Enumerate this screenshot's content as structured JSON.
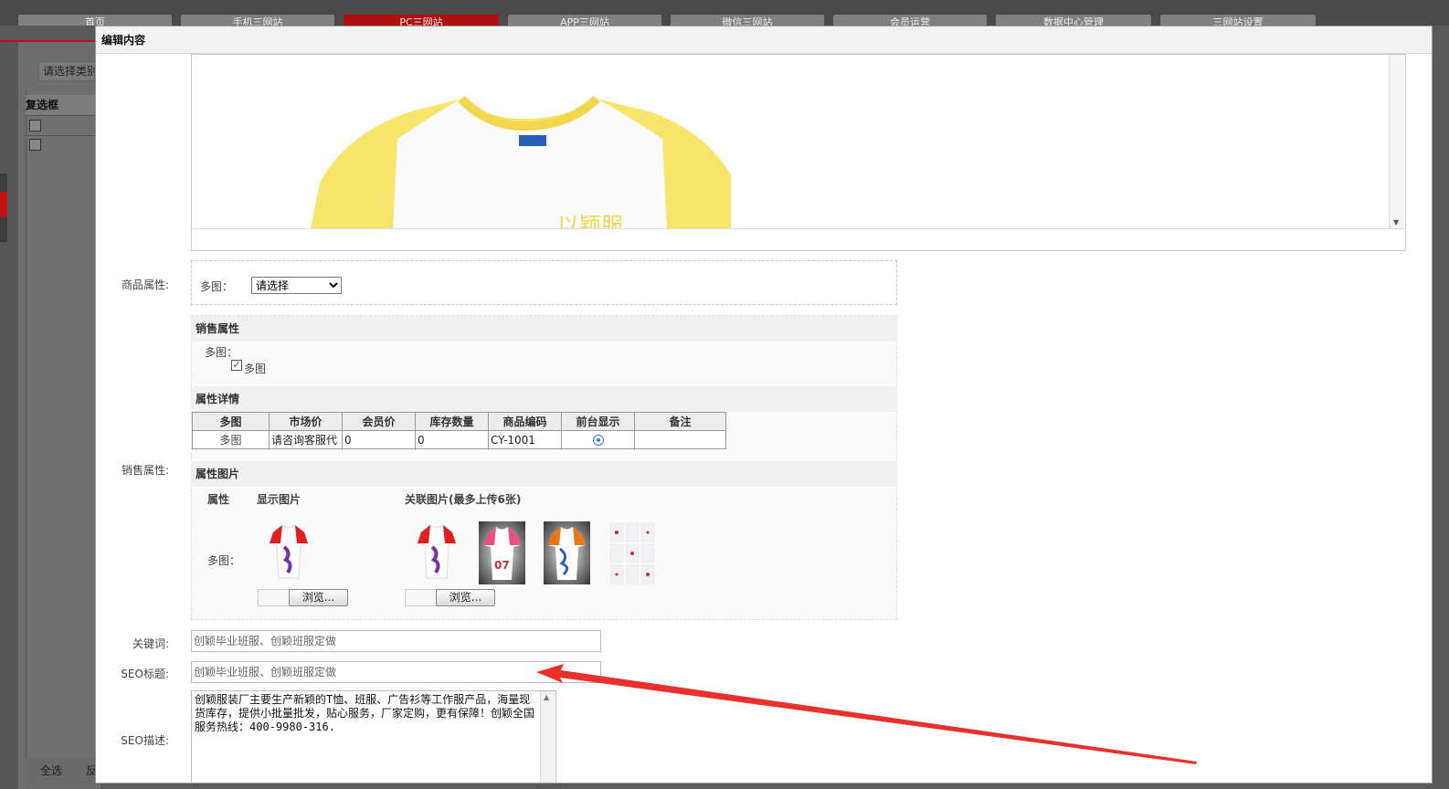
{
  "background": {
    "nav_tabs": [
      {
        "label": "首页"
      },
      {
        "label": "手机三网站"
      },
      {
        "label": "PC三网站"
      },
      {
        "label": "APP三网站"
      },
      {
        "label": "微信三网站"
      },
      {
        "label": "会员运营"
      },
      {
        "label": "数据中心管理"
      },
      {
        "label": "三网站设置"
      }
    ],
    "category_select": "请选择类别",
    "list_header": "复选框",
    "footer_select_all": "全选",
    "footer_invert": "反选"
  },
  "modal": {
    "title": "编辑内容",
    "product_attr": {
      "label": "商品属性:",
      "field_label": "多图：",
      "select_value": "请选择"
    },
    "sale_attr": {
      "label": "销售属性:",
      "section_sales": "销售属性",
      "sales_item_label": "多图：",
      "sales_checkbox_label": "多图",
      "section_detail": "属性详情",
      "table": {
        "headers": [
          "多图",
          "市场价",
          "会员价",
          "库存数量",
          "商品编码",
          "前台显示",
          "备注"
        ],
        "row": {
          "name": "多图",
          "market_price": "请咨询客服代",
          "member_price": "0",
          "stock": "0",
          "code": "CY-1001",
          "note": ""
        }
      },
      "section_images": "属性图片",
      "col_attr": "属性",
      "col_show": "显示图片",
      "col_related": "关联图片(最多上传6张)",
      "row_label": "多图：",
      "browse_label": "浏览..."
    },
    "keywords": {
      "label": "关键词:",
      "value": "创颖毕业班服、创颖班服定做"
    },
    "seo_title": {
      "label": "SEO标题:",
      "value": "创颖毕业班服、创颖班服定做"
    },
    "seo_desc": {
      "label": "SEO描述:",
      "value": "创颖服装厂主要生产新颖的T恤、班服、广告衫等工作服产品，海量现货库存，提供小批量批发，贴心服务，厂家定购，更有保障！创颖全国服务热线：400-9980-316."
    }
  },
  "colors": {
    "accent": "#c01010",
    "arrow": "#e8312d",
    "shirt_yellow": "#f7e46b"
  }
}
